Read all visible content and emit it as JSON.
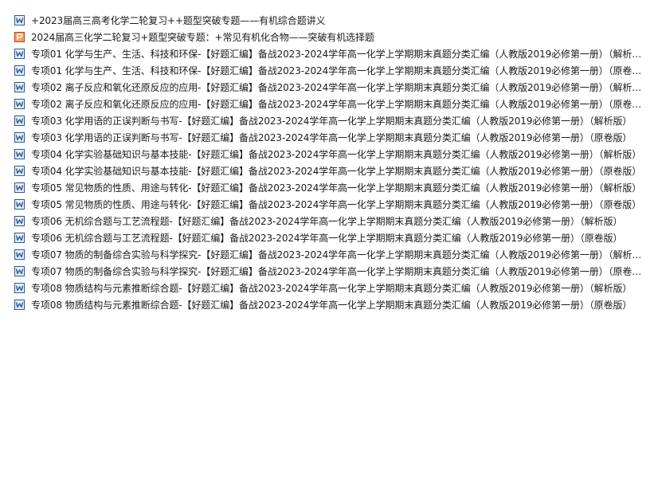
{
  "files": [
    {
      "name": "+2023届高三高考化学二轮复习++题型突破专题——有机综合题讲义",
      "icon": "word-doc-icon",
      "type": "docx"
    },
    {
      "name": "2024届高三化学二轮复习+题型突破专题：+常见有机化合物——突破有机选择题",
      "icon": "ppt-doc-icon",
      "type": "ppt"
    },
    {
      "name": "专项01 化学与生产、生活、科技和环保-【好题汇编】备战2023-2024学年高一化学上学期期末真题分类汇编（人教版2019必修第一册）（解析…",
      "icon": "word-doc-icon",
      "type": "docx"
    },
    {
      "name": "专项01 化学与生产、生活、科技和环保-【好题汇编】备战2023-2024学年高一化学上学期期末真题分类汇编（人教版2019必修第一册）（原卷…",
      "icon": "word-doc-icon",
      "type": "docx"
    },
    {
      "name": "专项02 离子反应和氧化还原反应的应用-【好题汇编】备战2023-2024学年高一化学上学期期末真题分类汇编（人教版2019必修第一册）（解析…",
      "icon": "word-doc-icon",
      "type": "docx"
    },
    {
      "name": "专项02 离子反应和氧化还原反应的应用-【好题汇编】备战2023-2024学年高一化学上学期期末真题分类汇编（人教版2019必修第一册）（原卷…",
      "icon": "word-doc-icon",
      "type": "docx"
    },
    {
      "name": "专项03 化学用语的正误判断与书写-【好题汇编】备战2023-2024学年高一化学上学期期末真题分类汇编（人教版2019必修第一册）（解析版）",
      "icon": "word-doc-icon",
      "type": "docx"
    },
    {
      "name": "专项03 化学用语的正误判断与书写-【好题汇编】备战2023-2024学年高一化学上学期期末真题分类汇编（人教版2019必修第一册）（原卷版）",
      "icon": "word-doc-icon",
      "type": "docx"
    },
    {
      "name": "专项04 化学实验基础知识与基本技能-【好题汇编】备战2023-2024学年高一化学上学期期末真题分类汇编（人教版2019必修第一册）（解析版）",
      "icon": "word-doc-icon",
      "type": "docx"
    },
    {
      "name": "专项04 化学实验基础知识与基本技能-【好题汇编】备战2023-2024学年高一化学上学期期末真题分类汇编（人教版2019必修第一册）（原卷版）",
      "icon": "word-doc-icon",
      "type": "docx"
    },
    {
      "name": "专项05 常见物质的性质、用途与转化-【好题汇编】备战2023-2024学年高一化学上学期期末真题分类汇编（人教版2019必修第一册）（解析版）",
      "icon": "word-doc-icon",
      "type": "docx"
    },
    {
      "name": "专项05 常见物质的性质、用途与转化-【好题汇编】备战2023-2024学年高一化学上学期期末真题分类汇编（人教版2019必修第一册）（原卷版）",
      "icon": "word-doc-icon",
      "type": "docx"
    },
    {
      "name": "专项06 无机综合题与工艺流程题-【好题汇编】备战2023-2024学年高一化学上学期期末真题分类汇编（人教版2019必修第一册）（解析版）",
      "icon": "word-doc-icon",
      "type": "docx"
    },
    {
      "name": "专项06 无机综合题与工艺流程题-【好题汇编】备战2023-2024学年高一化学上学期期末真题分类汇编（人教版2019必修第一册）（原卷版）",
      "icon": "word-doc-icon",
      "type": "docx"
    },
    {
      "name": "专项07 物质的制备综合实验与科学探究-【好题汇编】备战2023-2024学年高一化学上学期期末真题分类汇编（人教版2019必修第一册）（解析…",
      "icon": "word-doc-icon",
      "type": "docx"
    },
    {
      "name": "专项07 物质的制备综合实验与科学探究-【好题汇编】备战2023-2024学年高一化学上学期期末真题分类汇编（人教版2019必修第一册）（原卷…",
      "icon": "word-doc-icon",
      "type": "docx"
    },
    {
      "name": "专项08 物质结构与元素推断综合题-【好题汇编】备战2023-2024学年高一化学上学期期末真题分类汇编（人教版2019必修第一册）（解析版）",
      "icon": "word-doc-icon",
      "type": "docx"
    },
    {
      "name": "专项08 物质结构与元素推断综合题-【好题汇编】备战2023-2024学年高一化学上学期期末真题分类汇编（人教版2019必修第一册）（原卷版）",
      "icon": "word-doc-icon",
      "type": "docx"
    }
  ],
  "colors": {
    "word_icon": "#2b5797",
    "ppt_icon": "#d24726",
    "text": "#1a1a1a",
    "background": "#ffffff"
  }
}
